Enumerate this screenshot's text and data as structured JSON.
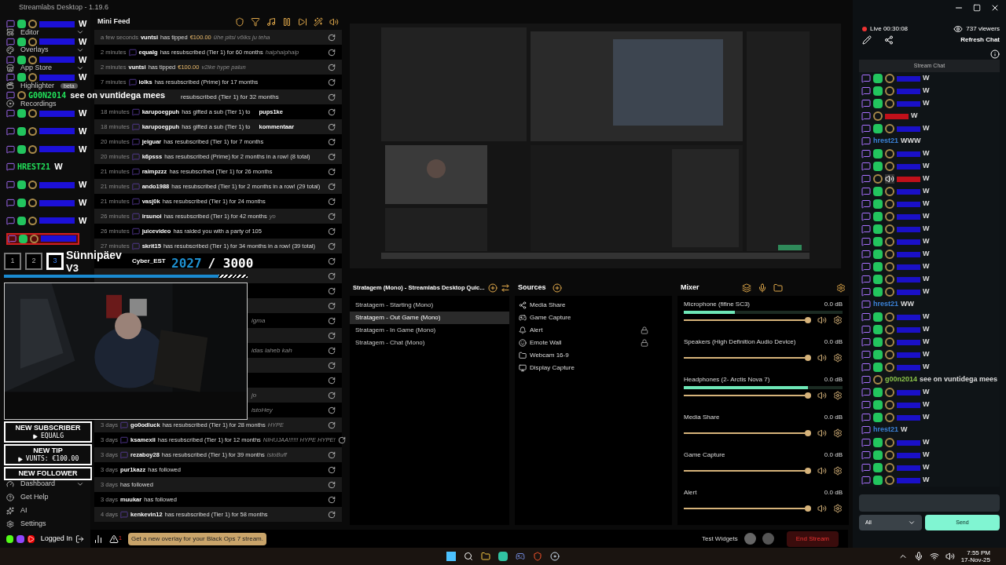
{
  "app": {
    "title": "Streamlabs Desktop - 1.19.6"
  },
  "nav": {
    "top": [
      {
        "label": "Editor",
        "kind": "editor",
        "expandable": true
      },
      {
        "label": "Overlays",
        "kind": "overlays",
        "expandable": true
      },
      {
        "label": "App Store",
        "kind": "store",
        "expandable": true
      },
      {
        "label": "Highlighter",
        "kind": "highlighter",
        "expandable": false,
        "badge": "beta"
      },
      {
        "label": "Recordings",
        "kind": "recordings",
        "expandable": false
      }
    ],
    "bottom": [
      {
        "label": "Dashboard",
        "kind": "dashboard",
        "expandable": true
      },
      {
        "label": "Get Help",
        "kind": "help",
        "expandable": false
      },
      {
        "label": "AI",
        "kind": "ai",
        "expandable": false
      },
      {
        "label": "Settings",
        "kind": "settings",
        "expandable": false
      }
    ],
    "account": "Logged In"
  },
  "mini_feed": {
    "title": "Mini Feed",
    "rows": [
      {
        "time": "a few seconds",
        "platform": false,
        "user": "vuntsi",
        "action": "has tipped",
        "amount": "€100.00",
        "message": "ühe pitsi võiks ju teha"
      },
      {
        "time": "2 minutes",
        "platform": true,
        "user": "equalg",
        "action": "has resubscribed (Tier 1) for 60 months",
        "message": "haiphaiphaip"
      },
      {
        "time": "2 minutes",
        "platform": false,
        "user": "vuntsi",
        "action": "has tipped",
        "amount": "€100.00",
        "message": "v2ike hype palun"
      },
      {
        "time": "7 minutes",
        "platform": true,
        "user": "iolks",
        "action": "has resubscribed (Prime) for 17 months"
      },
      {
        "kind": "after_overlay",
        "action": "resubscribed (Tier 1) for 32 months"
      },
      {
        "time": "18 minutes",
        "platform": true,
        "user": "karupoegpuh",
        "action": "has gifted a sub (Tier 1) to",
        "target": "pups1ke"
      },
      {
        "time": "18 minutes",
        "platform": true,
        "user": "karupoegpuh",
        "action": "has gifted a sub (Tier 1) to",
        "target": "kommentaar"
      },
      {
        "time": "20 minutes",
        "platform": true,
        "user": "jeiguar",
        "action": "has resubscribed (Tier 1) for 7 months"
      },
      {
        "time": "20 minutes",
        "platform": true,
        "user": "k6psss",
        "action": "has resubscribed (Prime) for 2 months in a row! (8 total)"
      },
      {
        "time": "21 minutes",
        "platform": true,
        "user": "raimpzzz",
        "action": "has resubscribed (Tier 1) for 26 months"
      },
      {
        "time": "21 minutes",
        "platform": true,
        "user": "ando1988",
        "action": "has resubscribed (Tier 1) for 2 months in a row! (29 total)"
      },
      {
        "time": "21 minutes",
        "platform": true,
        "user": "vasj0k",
        "action": "has resubscribed (Tier 1) for 24 months"
      },
      {
        "time": "26 minutes",
        "platform": true,
        "user": "irsunoi",
        "action": "has resubscribed (Tier 1) for 42 months",
        "message": "yo"
      },
      {
        "time": "26 minutes",
        "platform": true,
        "user": "juicevideo",
        "action": "has raided you with a party of 105"
      },
      {
        "time": "27 minutes",
        "platform": true,
        "user": "skrit15",
        "action": "has resubscribed (Tier 1) for 34 months in a row! (39 total)"
      },
      {
        "kind": "after_goal",
        "user": "Cyber_EST"
      },
      {
        "kind": "covered"
      },
      {
        "kind": "covered"
      },
      {
        "kind": "covered"
      },
      {
        "kind": "covered",
        "message": "igma"
      },
      {
        "kind": "covered"
      },
      {
        "kind": "covered",
        "message": "idas laheb kah"
      },
      {
        "kind": "covered"
      },
      {
        "kind": "covered"
      },
      {
        "kind": "covered",
        "message": "jo"
      },
      {
        "kind": "covered",
        "message": "istoHey"
      },
      {
        "time": "3 days",
        "platform": true,
        "user": "go0odluck",
        "action": "has resubscribed (Tier 1) for 28 months",
        "message": "HYPE"
      },
      {
        "time": "3 days",
        "platform": true,
        "user": "ksamexii",
        "action": "has resubscribed (Tier 1) for 12 months",
        "message": "NIHUJAA!!!!!! HYPE HYPE!"
      },
      {
        "time": "3 days",
        "platform": true,
        "user": "rezaboy28",
        "action": "has resubscribed (Tier 1) for 39 months",
        "message": "istoBuff"
      },
      {
        "time": "3 days",
        "platform": false,
        "user": "pur1kazz",
        "action": "has followed"
      },
      {
        "time": "3 days",
        "platform": false,
        "action": "has followed"
      },
      {
        "time": "3 days",
        "platform": false,
        "user": "muukar",
        "action": "has followed"
      },
      {
        "time": "4 days",
        "platform": true,
        "user": "kenkevin12",
        "action": "has resubscribed (Tier 1) for 58 months"
      }
    ]
  },
  "stream_overlay": {
    "chat": [
      {
        "kind": "sub",
        "color": "#1c10d8",
        "message": "W",
        "highlighted": false
      },
      {
        "kind": "sub",
        "color": "#1c10d8",
        "message": "W",
        "highlighted": false
      },
      {
        "kind": "sub",
        "color": "#1c10d8",
        "message": "W",
        "highlighted": false
      },
      {
        "kind": "sub",
        "color": "#1c10d8",
        "message": "W",
        "highlighted": false
      },
      {
        "kind": "snail",
        "user": "G00N2014",
        "color": "#22e05a",
        "message": "see on vuntidega mees",
        "highlighted": false
      },
      {
        "kind": "sub",
        "color": "#1c10d8",
        "message": "W",
        "highlighted": false
      },
      {
        "kind": "sub",
        "color": "#1c10d8",
        "message": "W",
        "highlighted": false
      },
      {
        "kind": "sub",
        "color": "#1c10d8",
        "message": "W",
        "highlighted": false
      },
      {
        "kind": "plain",
        "user": "HREST21",
        "color": "#22e05a",
        "message": "W",
        "highlighted": false
      },
      {
        "kind": "sub",
        "color": "#1c10d8",
        "message": "W",
        "highlighted": false
      },
      {
        "kind": "sub",
        "color": "#1c10d8",
        "message": "W",
        "highlighted": false
      },
      {
        "kind": "sub",
        "color": "#1c10d8",
        "message": "W",
        "highlighted": false
      },
      {
        "kind": "sub",
        "color": "#1c10d8",
        "highlighted": true
      }
    ],
    "scene_buttons": [
      {
        "label": "1",
        "selected": false
      },
      {
        "label": "2",
        "selected": false
      },
      {
        "label": "3",
        "selected": true
      }
    ],
    "goal": {
      "title": "Sünnipäev",
      "subtitle": "V3",
      "current": "2027",
      "target": "/ 3000",
      "level": 0.88
    },
    "alerts": [
      {
        "label": "NEW SUBSCRIBER",
        "value": "EQUALG"
      },
      {
        "label": "NEW TIP",
        "value": "VUNTS: €100.00"
      },
      {
        "label": "NEW FOLLOWER"
      }
    ]
  },
  "scenes": {
    "title": "Stratagem (Mono) - Streamlabs Desktop Quic...",
    "items": [
      {
        "label": "Stratagem - Starting (Mono)",
        "selected": false
      },
      {
        "label": "Stratagem - Out Game (Mono)",
        "selected": true
      },
      {
        "label": "Stratagem - In Game (Mono)",
        "selected": false
      },
      {
        "label": "Stratagem - Chat (Mono)",
        "selected": false
      }
    ]
  },
  "sources": {
    "title": "Sources",
    "items": [
      {
        "label": "Media Share",
        "kind": "share",
        "locked": false
      },
      {
        "label": "Game Capture",
        "kind": "game",
        "locked": false
      },
      {
        "label": "Alert",
        "kind": "alert",
        "locked": true
      },
      {
        "label": "Emote Wall",
        "kind": "emote",
        "locked": true
      },
      {
        "label": "Webcam 16-9",
        "kind": "folder",
        "locked": false
      },
      {
        "label": "Display Capture",
        "kind": "display",
        "locked": false
      }
    ]
  },
  "mixer": {
    "title": "Mixer",
    "channels": [
      {
        "name": "Microphone (fifine SC3)",
        "reading": "0.0 dB",
        "level": 1,
        "meter": {
          "level": 0.32
        }
      },
      {
        "name": "Speakers (High Definition Audio Device)",
        "reading": "0.0 dB",
        "level": 1
      },
      {
        "name": "Headphones (2- Arctis Nova 7)",
        "reading": "0.0 dB",
        "level": 1,
        "meter": {
          "level": 0.78
        }
      },
      {
        "name": "Media Share",
        "reading": "0.0 dB",
        "level": 1
      },
      {
        "name": "Game Capture",
        "reading": "0.0 dB",
        "level": 1
      },
      {
        "name": "Alert",
        "reading": "0.0 dB",
        "level": 1
      }
    ]
  },
  "chat": {
    "live": "Live 00:30:08",
    "viewers": "737 viewers",
    "refresh": "Refresh Chat",
    "header": "Stream Chat",
    "messages": [
      {
        "kind": "sub",
        "color": "#1a10c8",
        "message": "W"
      },
      {
        "kind": "sub",
        "color": "#1a10c8",
        "message": "W"
      },
      {
        "kind": "sub",
        "color": "#1a10c8",
        "message": "W"
      },
      {
        "kind": "snail",
        "color": "#c0101a",
        "message": "W"
      },
      {
        "kind": "sub",
        "color": "#1a10c8",
        "message": "W"
      },
      {
        "kind": "plain",
        "user": "hrest21",
        "color": "#3b82d6",
        "message": "WWW"
      },
      {
        "kind": "sub",
        "color": "#1a10c8",
        "message": "W"
      },
      {
        "kind": "sub",
        "color": "#1a10c8",
        "message": "W"
      },
      {
        "kind": "speaker",
        "color": "#c0101a",
        "message": "W"
      },
      {
        "kind": "sub",
        "color": "#1a10c8",
        "message": "W"
      },
      {
        "kind": "sub",
        "color": "#1a10c8",
        "message": "W"
      },
      {
        "kind": "sub",
        "color": "#1a10c8",
        "message": "W"
      },
      {
        "kind": "sub",
        "color": "#1a10c8",
        "message": "W"
      },
      {
        "kind": "sub",
        "color": "#1a10c8",
        "message": "W"
      },
      {
        "kind": "sub",
        "color": "#1a10c8",
        "message": "W"
      },
      {
        "kind": "sub",
        "color": "#1a10c8",
        "message": "W"
      },
      {
        "kind": "sub",
        "color": "#1a10c8",
        "message": "W"
      },
      {
        "kind": "sub",
        "color": "#1a10c8",
        "message": "W"
      },
      {
        "kind": "plain",
        "user": "hrest21",
        "color": "#3b82d6",
        "message": "WW"
      },
      {
        "kind": "sub",
        "color": "#1a10c8",
        "message": "W"
      },
      {
        "kind": "sub",
        "color": "#1a10c8",
        "message": "W"
      },
      {
        "kind": "sub",
        "color": "#1a10c8",
        "message": "W"
      },
      {
        "kind": "sub",
        "color": "#1a10c8",
        "message": "W"
      },
      {
        "kind": "sub",
        "color": "#1a10c8",
        "message": "W"
      },
      {
        "kind": "snail",
        "user": "g00n2014",
        "color": "#8bc34a",
        "message": "see on vuntidega mees"
      },
      {
        "kind": "sub",
        "color": "#1a10c8",
        "message": "W"
      },
      {
        "kind": "sub",
        "color": "#1a10c8",
        "message": "W"
      },
      {
        "kind": "sub",
        "color": "#1a10c8",
        "message": "W"
      },
      {
        "kind": "plain",
        "user": "hrest21",
        "color": "#3b82d6",
        "message": "W"
      },
      {
        "kind": "sub",
        "color": "#1a10c8",
        "message": "W"
      },
      {
        "kind": "sub",
        "color": "#1a10c8",
        "message": "W"
      },
      {
        "kind": "sub",
        "color": "#1a10c8",
        "message": "W"
      },
      {
        "kind": "sub",
        "color": "#1a10c8",
        "message": "W"
      }
    ],
    "filter": "All",
    "send": "Send"
  },
  "status_bar": {
    "alert_count": "1",
    "promo": "Get a new overlay for your Black Ops 7 stream.",
    "test_widgets": "Test Widgets",
    "end_stream": "End Stream"
  },
  "taskbar": {
    "time": "7:55 PM",
    "date": "17-Nov-25"
  }
}
